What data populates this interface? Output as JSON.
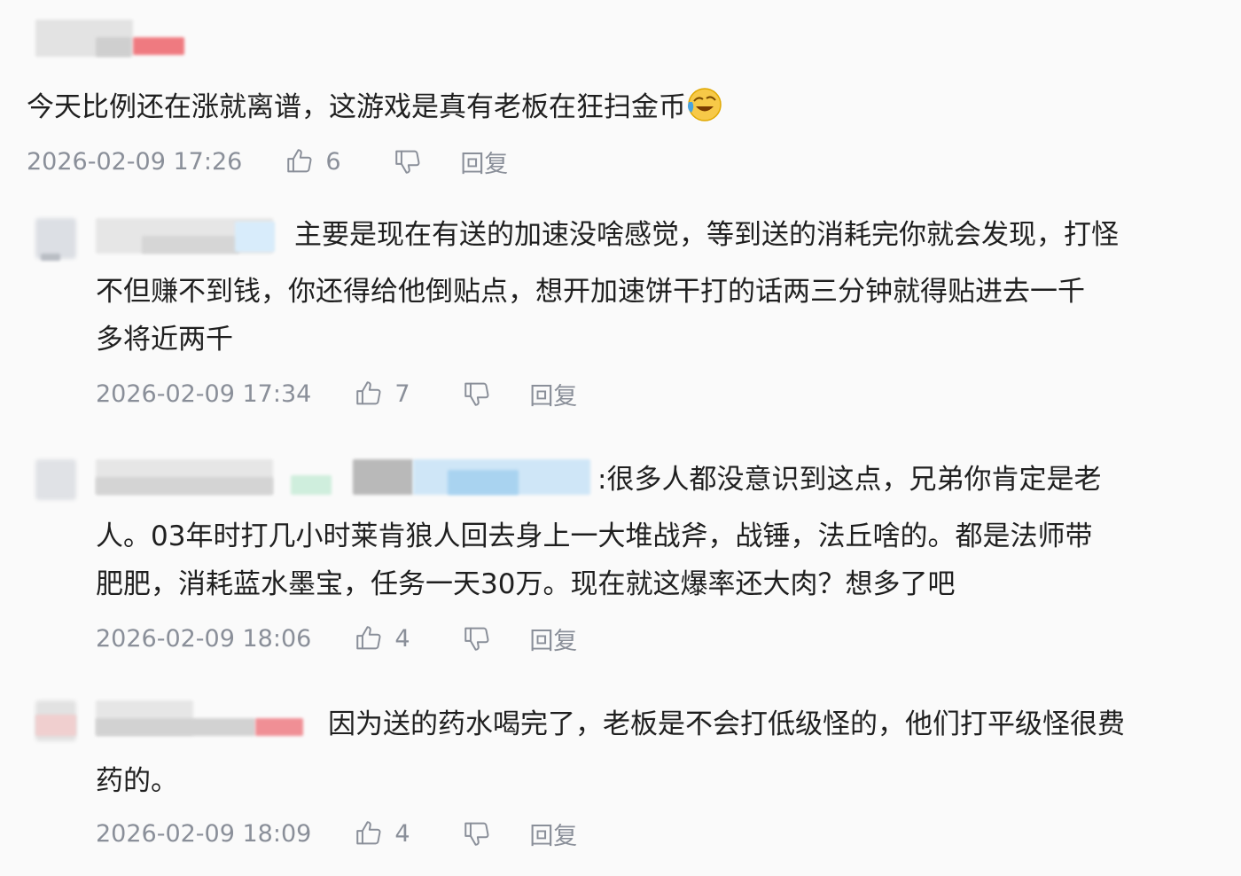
{
  "comments": [
    {
      "text": "今天比例还在涨就离谱，这游戏是真有老板在狂扫金币",
      "emoji_icon": "crying-laughing-emoji-icon",
      "time": "2026-02-09 17:26",
      "likes": "6",
      "reply_label": "回复"
    },
    {
      "line1": "主要是现在有送的加速没啥感觉，等到送的消耗完你就会发现，打怪",
      "line2": "不但赚不到钱，你还得给他倒贴点，想开加速饼干打的话两三分钟就得贴进去一千",
      "line3": "多将近两千",
      "time": "2026-02-09 17:34",
      "likes": "7",
      "reply_label": "回复"
    },
    {
      "line1": ":很多人都没意识到这点，兄弟你肯定是老",
      "line2": "人。03年时打几小时莱肯狼人回去身上一大堆战斧，战锤，法丘啥的。都是法师带",
      "line3": "肥肥，消耗蓝水墨宝，任务一天30万。现在就这爆率还大肉？想多了吧",
      "time": "2026-02-09 18:06",
      "likes": "4",
      "reply_label": "回复"
    },
    {
      "line1": "因为送的药水喝完了，老板是不会打低级怪的，他们打平级怪很费",
      "line2": "药的。",
      "time": "2026-02-09 18:09",
      "likes": "4",
      "reply_label": "回复"
    }
  ],
  "icons": {
    "like": "thumbs-up-icon",
    "dislike": "thumbs-down-icon"
  },
  "colors": {
    "background": "#fafafa",
    "text": "#1f1f1f",
    "meta": "#8a8f99"
  }
}
